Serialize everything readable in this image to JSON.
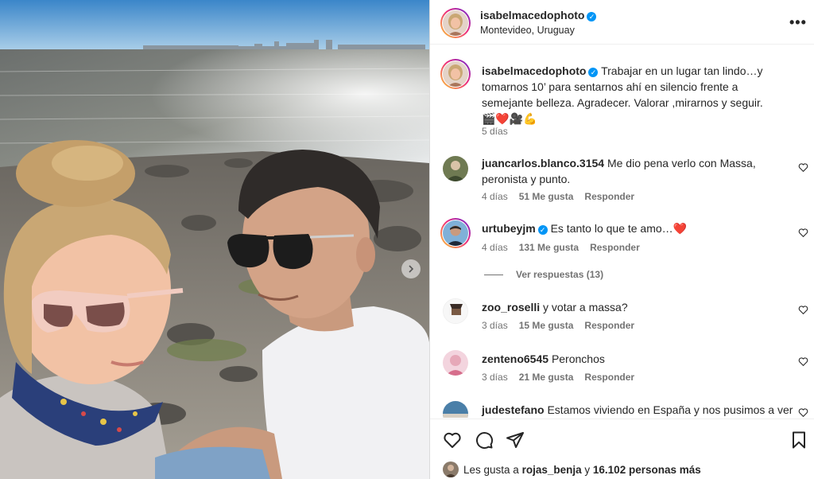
{
  "post": {
    "username": "isabelmacedophoto",
    "location": "Montevideo, Uruguay",
    "caption": "Trabajar en un lugar tan lindo…y tomarnos 10’ para sentarnos ahí en silencio frente a semejante belleza. Agradecer. Valorar ,mirarnos y seguir.",
    "caption_emojis": "🎬❤️🎥💪",
    "time": "5 días",
    "more_icon": "more-options-icon"
  },
  "comments": [
    {
      "username": "juancarlos.blanco.3154",
      "verified": false,
      "text": "Me dio pena verlo con Massa, peronista y punto.",
      "time": "4 días",
      "likes": "51 Me gusta",
      "reply": "Responder"
    },
    {
      "username": "urtubeyjm",
      "verified": true,
      "text": "Es tanto lo que te amo…",
      "heart": "❤️",
      "time": "4 días",
      "likes": "131 Me gusta",
      "reply": "Responder",
      "view_replies": "Ver respuestas (13)"
    },
    {
      "username": "zoo_roselli",
      "verified": false,
      "text": "y votar a massa?",
      "time": "3 días",
      "likes": "15 Me gusta",
      "reply": "Responder"
    },
    {
      "username": "zenteno6545",
      "verified": false,
      "text": "Peronchos",
      "time": "3 días",
      "likes": "21 Me gusta",
      "reply": "Responder"
    },
    {
      "username": "judestefano",
      "verified": false,
      "text": "Estamos viviendo en España y nos pusimos a ver",
      "time": "",
      "likes": "",
      "reply": ""
    }
  ],
  "likes_line": {
    "prefix": "Les gusta a",
    "user": "rojas_benja",
    "middle": "y",
    "count": "16.102 personas más"
  },
  "colors": {
    "verified": "#0095f6",
    "heart": "#ed1c24",
    "story_ring_start": "#f9ce34",
    "story_ring_mid": "#ee2a7b",
    "story_ring_end": "#6228d7"
  },
  "icons": [
    "like-icon",
    "comment-icon",
    "share-icon",
    "save-icon",
    "comment-like-icon",
    "verified-badge-icon"
  ]
}
